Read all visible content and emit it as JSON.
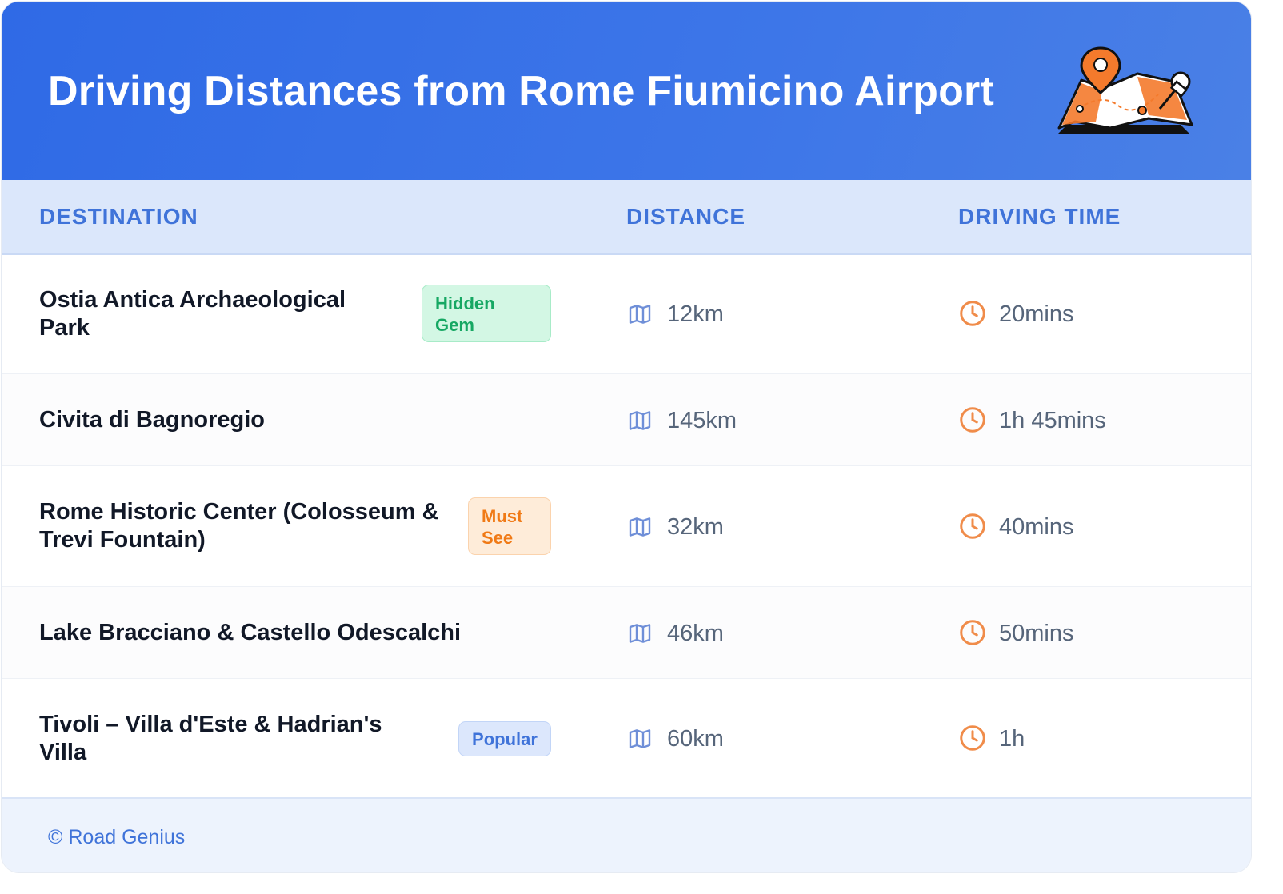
{
  "header": {
    "title": "Driving Distances from Rome Fiumicino Airport"
  },
  "table": {
    "columns": [
      "DESTINATION",
      "DISTANCE",
      "DRIVING TIME"
    ],
    "rows": [
      {
        "destination_line1": "Ostia Antica Archaeological",
        "destination_line2": "Park",
        "badge_line1": "Hidden",
        "badge_line2": "Gem",
        "distance": "12km",
        "time": "20mins"
      },
      {
        "destination_line1": "Civita di Bagnoregio",
        "destination_line2": "",
        "badge_line1": "",
        "badge_line2": "",
        "distance": "145km",
        "time": "1h 45mins"
      },
      {
        "destination_line1": "Rome Historic Center (Colosseum &",
        "destination_line2": "Trevi Fountain)",
        "badge_line1": "Must",
        "badge_line2": "See",
        "distance": "32km",
        "time": "40mins"
      },
      {
        "destination_line1": "Lake Bracciano & Castello Odescalchi",
        "destination_line2": "",
        "badge_line1": "",
        "badge_line2": "",
        "distance": "46km",
        "time": "50mins"
      },
      {
        "destination_line1": "Tivoli – Villa d'Este & Hadrian's",
        "destination_line2": "Villa",
        "badge_line1": "Popular",
        "badge_line2": "",
        "distance": "60km",
        "time": "1h"
      }
    ]
  },
  "footer": {
    "credit": "© Road Genius"
  },
  "colors": {
    "header": "#2f6ae6",
    "accent_blue": "#3f73d9",
    "badge_green": "#16a863",
    "badge_orange": "#f07a16",
    "clock_orange": "#f08c4a",
    "map_icon": "#6f8fd8"
  },
  "icons": {
    "distance": "map-icon",
    "time": "clock-icon",
    "illustration": "map-pin-illustration"
  }
}
